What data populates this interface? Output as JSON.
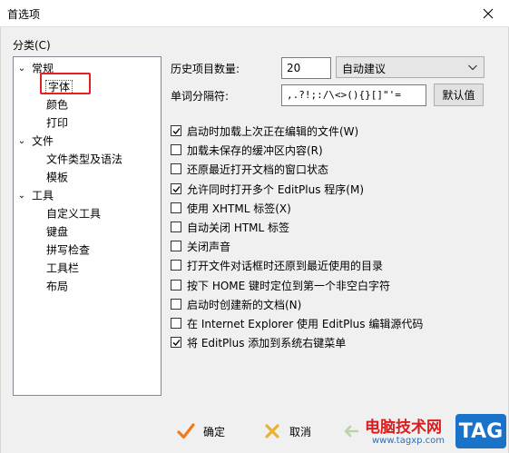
{
  "window": {
    "title": "首选项"
  },
  "sidebar": {
    "label": "分类(C)",
    "tree": [
      {
        "label": "常规",
        "toggle": "⌄",
        "level": 0
      },
      {
        "label": "字体",
        "toggle": "",
        "level": 1,
        "selected": true
      },
      {
        "label": "颜色",
        "toggle": "",
        "level": 1
      },
      {
        "label": "打印",
        "toggle": "",
        "level": 1
      },
      {
        "label": "文件",
        "toggle": "⌄",
        "level": 0
      },
      {
        "label": "文件类型及语法",
        "toggle": "",
        "level": 1
      },
      {
        "label": "模板",
        "toggle": "",
        "level": 1
      },
      {
        "label": "工具",
        "toggle": "⌄",
        "level": 0
      },
      {
        "label": "自定义工具",
        "toggle": "",
        "level": 1
      },
      {
        "label": "键盘",
        "toggle": "",
        "level": 1
      },
      {
        "label": "拼写检查",
        "toggle": "",
        "level": 1
      },
      {
        "label": "工具栏",
        "toggle": "",
        "level": 1
      },
      {
        "label": "布局",
        "toggle": "",
        "level": 1
      }
    ]
  },
  "settings": {
    "history_label": "历史项目数量:",
    "history_value": "20",
    "autocomplete_value": "自动建议",
    "word_sep_label": "单词分隔符:",
    "word_sep_value": ",.?!;:/\\<>(){}[]\"'=",
    "default_button": "默认值",
    "options": [
      {
        "label": "启动时加载上次正在编辑的文件(W)",
        "checked": true
      },
      {
        "label": "加载未保存的缓冲区内容(R)",
        "checked": false
      },
      {
        "label": "还原最近打开文档的窗口状态",
        "checked": false
      },
      {
        "label": "允许同时打开多个 EditPlus 程序(M)",
        "checked": true
      },
      {
        "label": "使用 XHTML 标签(X)",
        "checked": false
      },
      {
        "label": "自动关闭 HTML 标签",
        "checked": false
      },
      {
        "label": "关闭声音",
        "checked": false
      },
      {
        "label": "打开文件对话框时还原到最近使用的目录",
        "checked": false
      },
      {
        "label": "按下 HOME 键时定位到第一个非空白字符",
        "checked": false
      },
      {
        "label": "启动时创建新的文档(N)",
        "checked": false
      },
      {
        "label": "在 Internet Explorer 使用 EditPlus 编辑源代码",
        "checked": false
      },
      {
        "label": "将 EditPlus 添加到系统右键菜单",
        "checked": true
      }
    ]
  },
  "footer": {
    "ok_label": "确定",
    "cancel_label": "取消"
  },
  "watermark": {
    "site_name": "电脑技术网",
    "site_url": "www.tagxp.com",
    "tag": "TAG"
  },
  "colors": {
    "highlight": "#e52020",
    "ok_icon": "#f07a1a",
    "cancel_icon": "#e8b430",
    "watermark_text": "#d81e1e",
    "tag_bg": "#1b72c9"
  }
}
